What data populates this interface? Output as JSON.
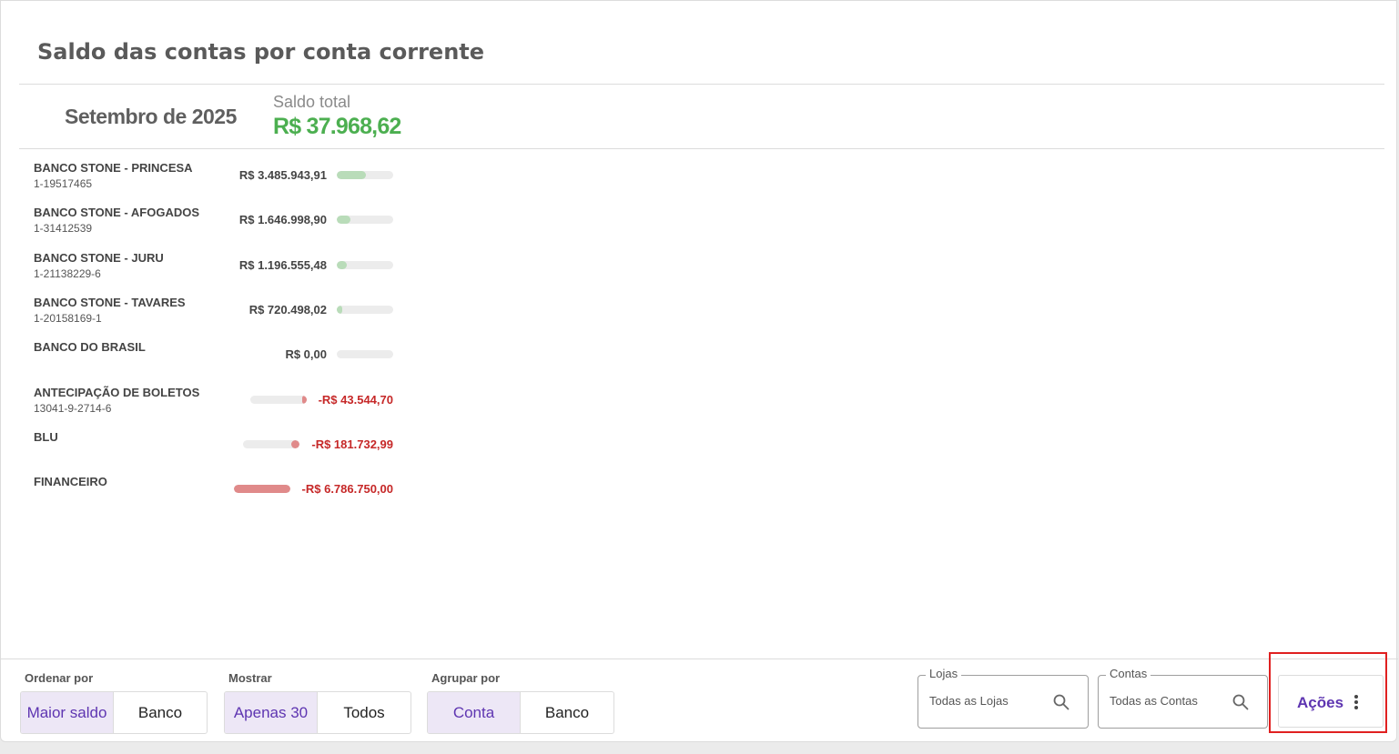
{
  "page": {
    "title": "Saldo das contas por conta corrente"
  },
  "summary": {
    "month": "Setembro de 2025",
    "total_label": "Saldo total",
    "total_value": "R$  37.968,62"
  },
  "accounts": [
    {
      "name": "BANCO STONE - PRINCESA",
      "number": "1-19517465",
      "amount": "R$  3.485.943,91",
      "sign": "positive",
      "bar_fraction": 0.51
    },
    {
      "name": "BANCO STONE - AFOGADOS",
      "number": "1-31412539",
      "amount": "R$  1.646.998,90",
      "sign": "positive",
      "bar_fraction": 0.24
    },
    {
      "name": "BANCO STONE - JURU",
      "number": "1-21138229-6",
      "amount": "R$  1.196.555,48",
      "sign": "positive",
      "bar_fraction": 0.18
    },
    {
      "name": "BANCO STONE - TAVARES",
      "number": "1-20158169-1",
      "amount": "R$  720.498,02",
      "sign": "positive",
      "bar_fraction": 0.1
    },
    {
      "name": "BANCO DO BRASIL",
      "number": "",
      "amount": "R$  0,00",
      "sign": "positive",
      "bar_fraction": 0
    },
    {
      "name": "ANTECIPAÇÃO DE BOLETOS",
      "number": "13041-9-2714-6",
      "amount": "-R$  43.544,70",
      "sign": "negative",
      "bar_fraction": 0.08
    },
    {
      "name": "BLU",
      "number": "",
      "amount": "-R$  181.732,99",
      "sign": "negative",
      "bar_fraction": 0.15
    },
    {
      "name": "FINANCEIRO",
      "number": "",
      "amount": "-R$  6.786.750,00",
      "sign": "negative",
      "bar_fraction": 1.0
    }
  ],
  "footer": {
    "ordenar": {
      "label": "Ordenar por",
      "options": [
        "Maior saldo",
        "Banco"
      ],
      "selected": 0
    },
    "mostrar": {
      "label": "Mostrar",
      "options": [
        "Apenas 30",
        "Todos"
      ],
      "selected": 0
    },
    "agrupar": {
      "label": "Agrupar por",
      "options": [
        "Conta",
        "Banco"
      ],
      "selected": 0
    },
    "lojas": {
      "label": "Lojas",
      "value": "Todas as Lojas"
    },
    "contas": {
      "label": "Contas",
      "value": "Todas as Contas"
    },
    "acoes": {
      "label": "Ações"
    }
  },
  "colors": {
    "accent": "#5e35b1",
    "positive_total": "#4caf50",
    "negative": "#c62828",
    "positive_bar": "#b9dcb9",
    "negative_bar": "#e08a8a",
    "highlight": "#e02020"
  }
}
